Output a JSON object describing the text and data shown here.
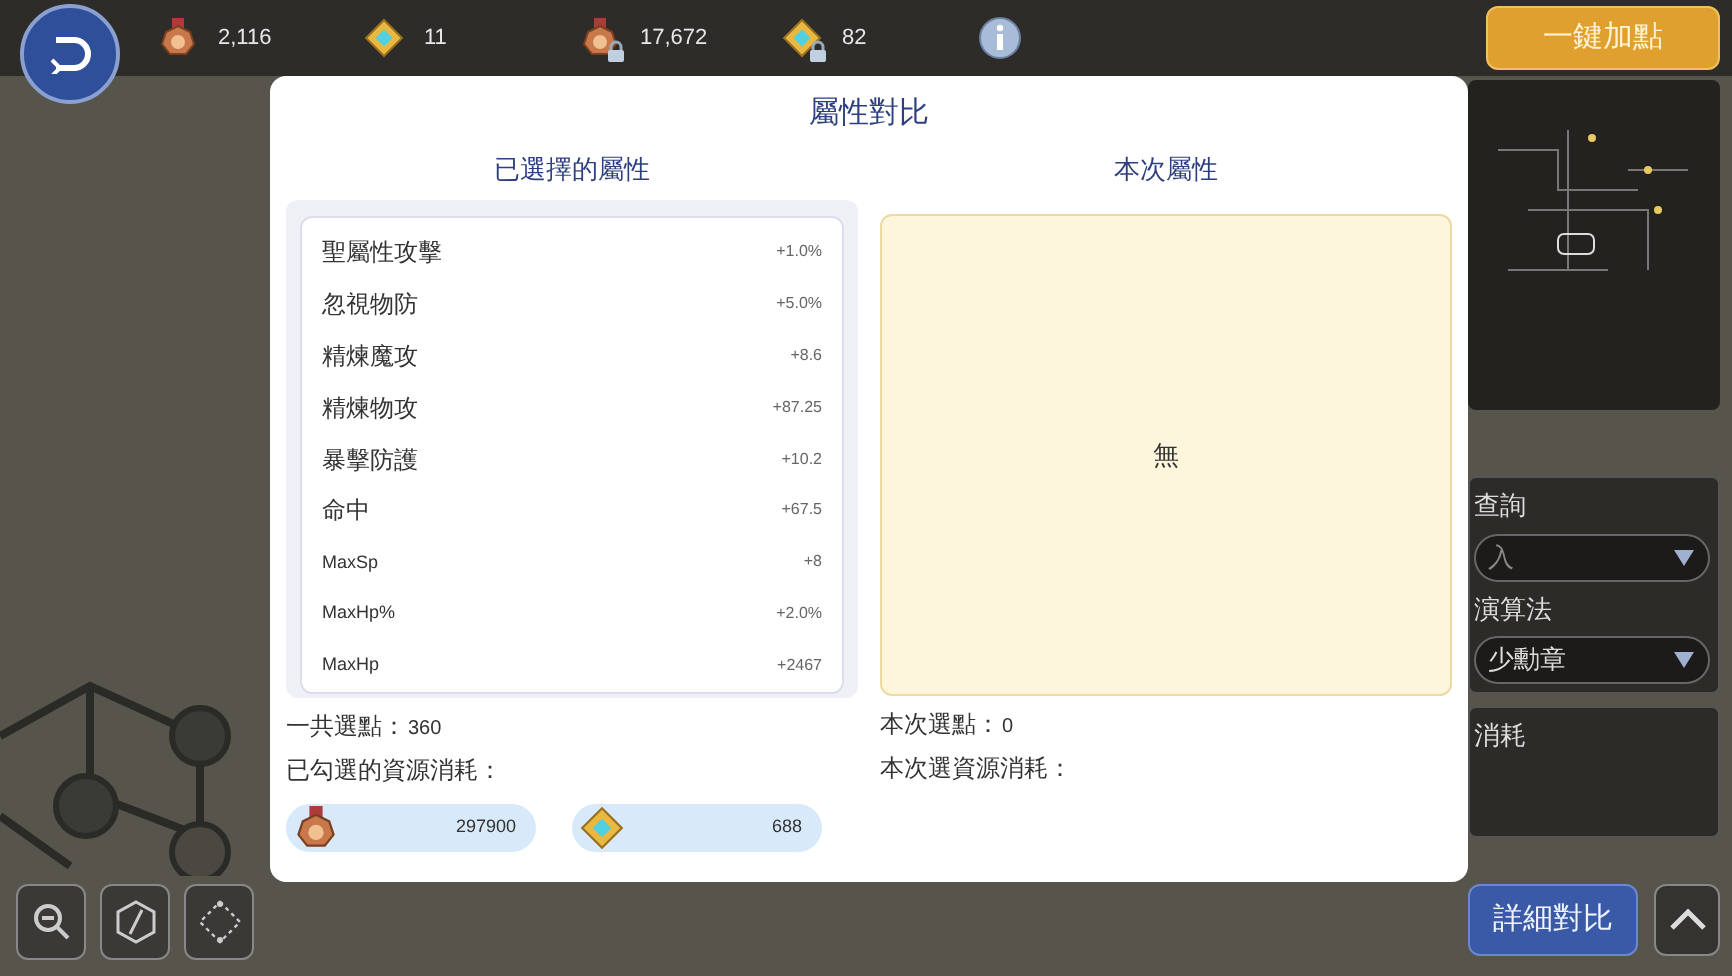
{
  "top_bar": {
    "resources": [
      {
        "kind": "medal",
        "locked": false,
        "value": "2,116"
      },
      {
        "kind": "crystal",
        "locked": false,
        "value": "11"
      },
      {
        "kind": "medal",
        "locked": true,
        "value": "17,672"
      },
      {
        "kind": "crystal",
        "locked": true,
        "value": "82"
      }
    ],
    "auto_button": "一鍵加點"
  },
  "side_panel": {
    "search_label": "查詢",
    "search_placeholder": "入",
    "algorithm_label": "演算法",
    "algorithm_value": "少勳章",
    "cost_label": "消耗"
  },
  "compare_button": "詳細對比",
  "modal": {
    "title": "屬性對比",
    "left": {
      "heading": "已選擇的屬性",
      "attributes": [
        {
          "name": "聖屬性攻擊",
          "value": "+1.0%"
        },
        {
          "name": "忽視物防",
          "value": "+5.0%"
        },
        {
          "name": "精煉魔攻",
          "value": "+8.6"
        },
        {
          "name": "精煉物攻",
          "value": "+87.25"
        },
        {
          "name": "暴擊防護",
          "value": "+10.2"
        },
        {
          "name": "命中",
          "value": "+67.5"
        },
        {
          "name": "MaxSp",
          "value": "+8"
        },
        {
          "name": "MaxHp%",
          "value": "+2.0%"
        },
        {
          "name": "MaxHp",
          "value": "+2467"
        }
      ],
      "total_label": "一共選點：",
      "total_value": "360",
      "cost_label": "已勾選的資源消耗：",
      "costs": [
        {
          "kind": "medal",
          "value": "297900"
        },
        {
          "kind": "crystal",
          "value": "688"
        }
      ]
    },
    "right": {
      "heading": "本次屬性",
      "empty_text": "無",
      "total_label": "本次選點：",
      "total_value": "0",
      "cost_label": "本次選資源消耗："
    }
  }
}
